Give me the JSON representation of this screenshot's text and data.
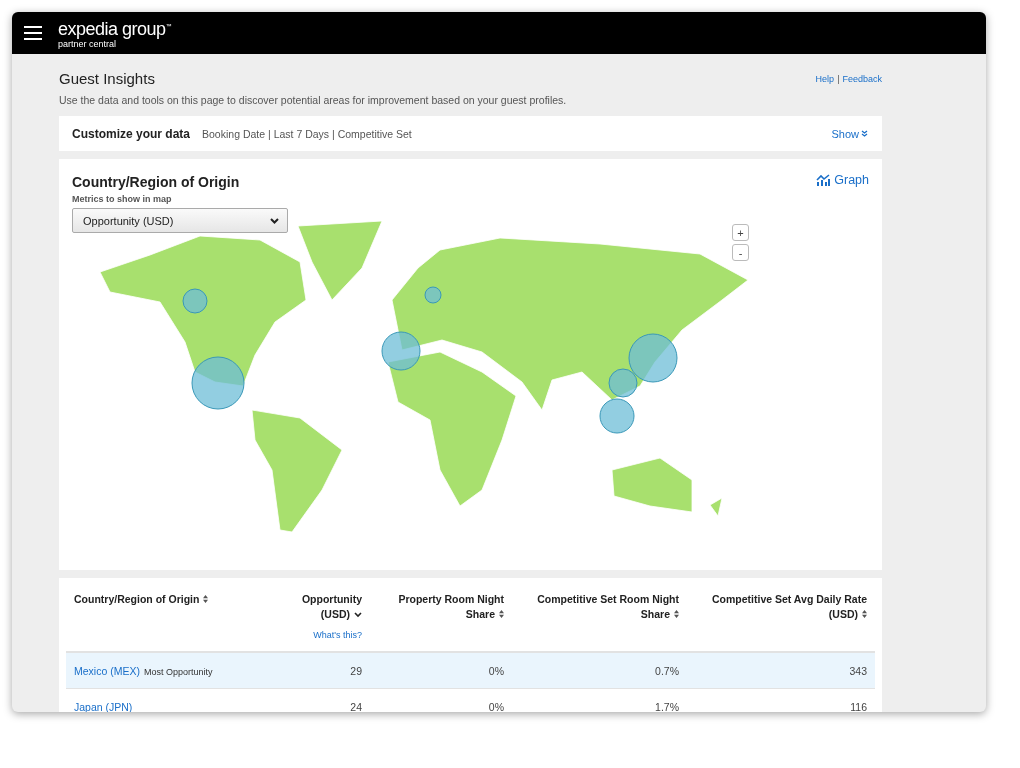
{
  "header": {
    "logo": "expedia group",
    "logo_mark": "™",
    "subtitle": "partner central"
  },
  "page": {
    "title": "Guest Insights",
    "links": [
      "Help",
      "Feedback"
    ],
    "separator": "|",
    "description": "Use the data and tools on this page to discover potential areas for improvement based on your guest profiles."
  },
  "customize": {
    "title": "Customize your data",
    "summary": "Booking Date | Last 7 Days | Competitive Set",
    "toggle": "Show"
  },
  "map_card": {
    "title": "Country/Region of Origin",
    "graph_link": "Graph",
    "metric_label": "Metrics to show in map",
    "metric_value": "Opportunity (USD)",
    "zoom_in": "+",
    "zoom_out": "-"
  },
  "table": {
    "columns": [
      {
        "label": "Country/Region of Origin",
        "sorted": false
      },
      {
        "label": "Opportunity (USD)",
        "sorted": true,
        "help": "What's this?"
      },
      {
        "label": "Property Room Night Share",
        "sorted": false
      },
      {
        "label": "Competitive Set Room Night Share",
        "sorted": false
      },
      {
        "label": "Competitive Set Avg Daily Rate (USD)",
        "sorted": false
      }
    ],
    "rows": [
      {
        "cells": [
          "Mexico (MEX)",
          "29",
          "0%",
          "0.7%",
          "343"
        ],
        "badge": "Most Opportunity",
        "selected": true
      },
      {
        "cells": [
          "Japan (JPN)",
          "24",
          "0%",
          "1.7%",
          "116"
        ],
        "selected": false
      }
    ]
  }
}
